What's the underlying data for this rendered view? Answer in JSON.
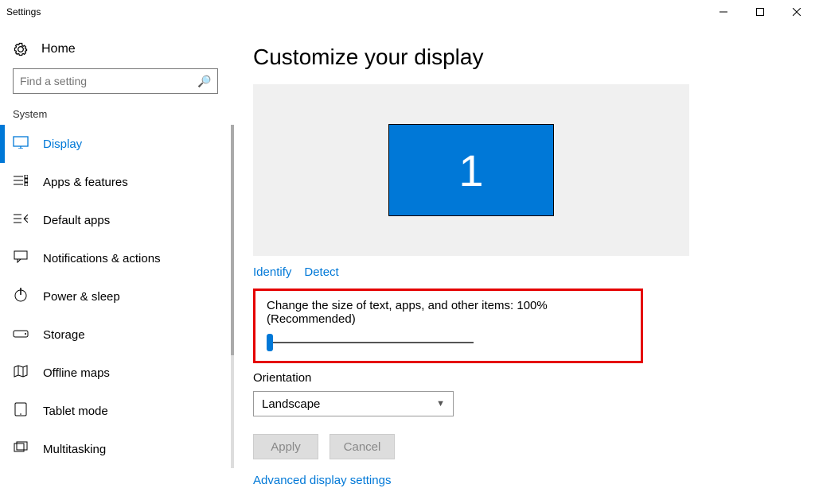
{
  "window": {
    "title": "Settings"
  },
  "sidebar": {
    "home": "Home",
    "searchPlaceholder": "Find a setting",
    "group": "System",
    "items": [
      {
        "label": "Display",
        "selected": true,
        "icon": "display-icon"
      },
      {
        "label": "Apps & features",
        "selected": false,
        "icon": "apps-icon"
      },
      {
        "label": "Default apps",
        "selected": false,
        "icon": "default-apps-icon"
      },
      {
        "label": "Notifications & actions",
        "selected": false,
        "icon": "notifications-icon"
      },
      {
        "label": "Power & sleep",
        "selected": false,
        "icon": "power-icon"
      },
      {
        "label": "Storage",
        "selected": false,
        "icon": "storage-icon"
      },
      {
        "label": "Offline maps",
        "selected": false,
        "icon": "maps-icon"
      },
      {
        "label": "Tablet mode",
        "selected": false,
        "icon": "tablet-icon"
      },
      {
        "label": "Multitasking",
        "selected": false,
        "icon": "multitask-icon"
      }
    ]
  },
  "main": {
    "heading": "Customize your display",
    "monitorLabel": "1",
    "identify": "Identify",
    "detect": "Detect",
    "scaleLabel": "Change the size of text, apps, and other items: 100% (Recommended)",
    "orientationLabel": "Orientation",
    "orientationValue": "Landscape",
    "apply": "Apply",
    "cancel": "Cancel",
    "advanced": "Advanced display settings"
  }
}
